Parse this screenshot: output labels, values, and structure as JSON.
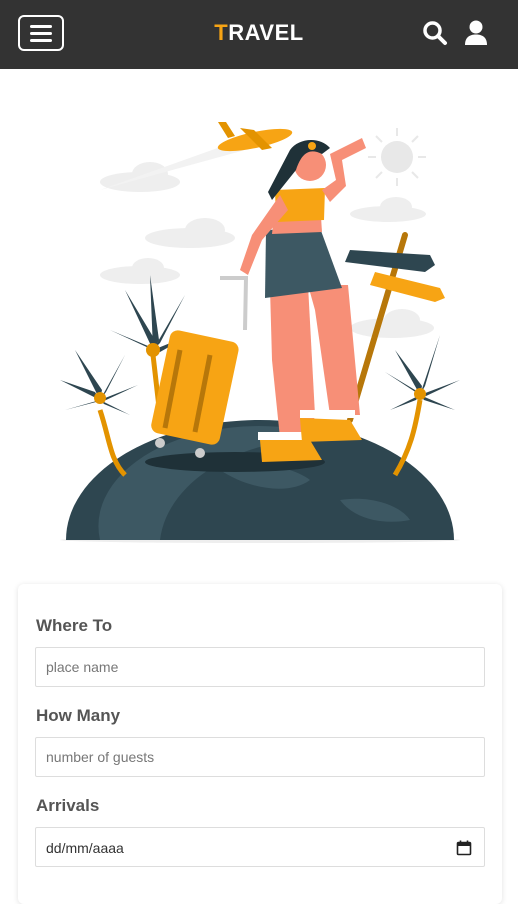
{
  "header": {
    "logo_first_letter": "T",
    "logo_rest": "RAVEL",
    "menu_icon": "hamburger-menu-icon",
    "search_icon": "search-icon",
    "user_icon": "user-icon",
    "background_color": "#333333",
    "accent_color": "#f7a414"
  },
  "hero": {
    "illustration": "traveler-woman-with-suitcase-on-globe-illustration"
  },
  "form": {
    "where_to_label": "Where To",
    "where_to_placeholder": "place name",
    "how_many_label": "How Many",
    "how_many_placeholder": "number of guests",
    "arrivals_label": "Arrivals",
    "arrivals_value": "dd/mm/aaaa",
    "calendar_icon": "calendar-icon"
  }
}
